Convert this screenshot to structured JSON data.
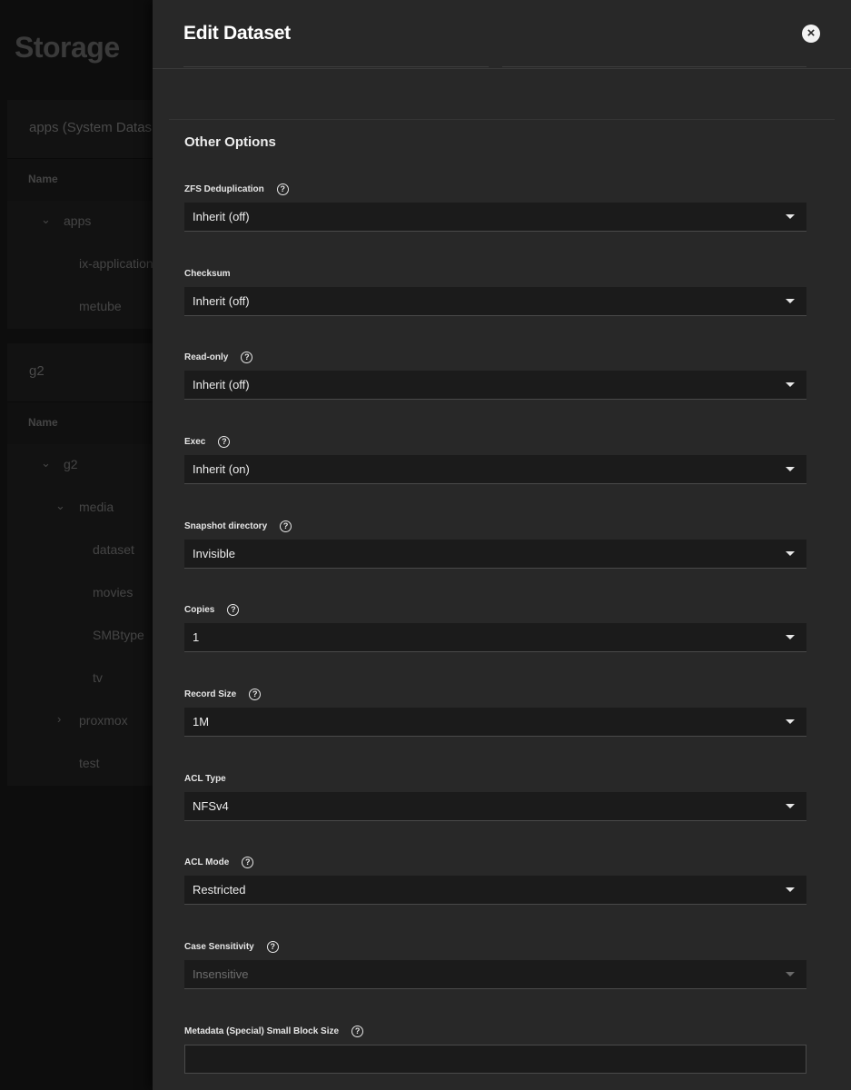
{
  "background": {
    "title": "Storage",
    "pools": [
      {
        "header": "apps   (System Datas",
        "column": "Name",
        "rows": [
          {
            "label": "apps",
            "chevron": "expanded"
          },
          {
            "label": "ix-application"
          },
          {
            "label": "metube"
          }
        ]
      },
      {
        "header": "g2",
        "column": "Name",
        "rows": [
          {
            "label": "g2",
            "chevron": "expanded"
          },
          {
            "label": "media",
            "chevron": "expanded"
          },
          {
            "label": "dataset"
          },
          {
            "label": "movies"
          },
          {
            "label": "SMBtype"
          },
          {
            "label": "tv"
          },
          {
            "label": "proxmox",
            "chevron": "collapsed"
          },
          {
            "label": "test"
          }
        ]
      }
    ]
  },
  "panel": {
    "title": "Edit Dataset",
    "close_icon": "×",
    "section_title": "Other Options",
    "help_icon": "?",
    "fields": [
      {
        "label": "ZFS Deduplication",
        "value": "Inherit (off)",
        "help": true
      },
      {
        "label": "Checksum",
        "value": "Inherit (off)",
        "help": false
      },
      {
        "label": "Read-only",
        "value": "Inherit (off)",
        "help": true
      },
      {
        "label": "Exec",
        "value": "Inherit (on)",
        "help": true
      },
      {
        "label": "Snapshot directory",
        "value": "Invisible",
        "help": true
      },
      {
        "label": "Copies",
        "value": "1",
        "help": true
      },
      {
        "label": "Record Size",
        "value": "1M",
        "help": true
      },
      {
        "label": "ACL Type",
        "value": "NFSv4",
        "help": false
      },
      {
        "label": "ACL Mode",
        "value": "Restricted",
        "help": true
      },
      {
        "label": "Case Sensitivity",
        "value": "Insensitive",
        "help": true,
        "disabled": true
      },
      {
        "label": "Metadata (Special) Small Block Size",
        "value": "",
        "help": true,
        "type": "text"
      }
    ]
  },
  "colors": {
    "panel_bg": "#282828",
    "input_bg": "#1b1b1b",
    "page_bg": "#0d0d0d"
  }
}
